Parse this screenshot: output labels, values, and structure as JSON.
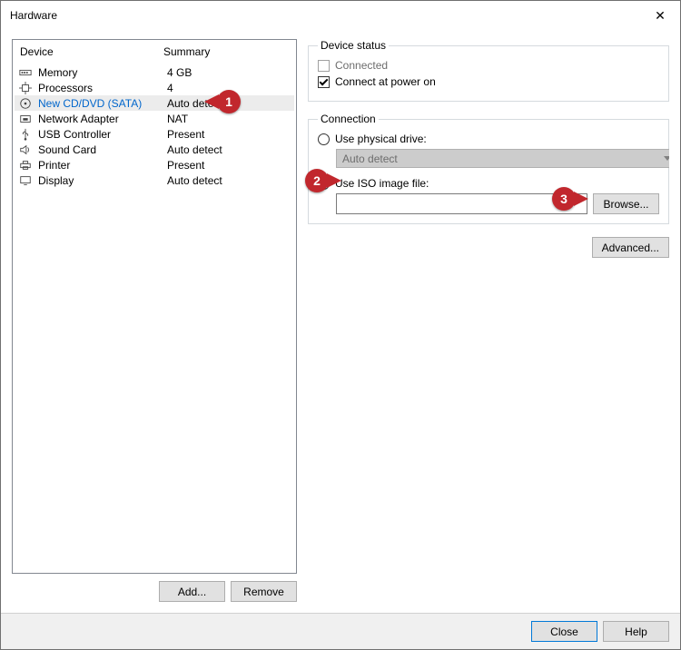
{
  "window": {
    "title": "Hardware",
    "close_icon": "✕"
  },
  "device_list": {
    "header_device": "Device",
    "header_summary": "Summary",
    "rows": [
      {
        "icon": "memory",
        "device": "Memory",
        "summary": "4 GB"
      },
      {
        "icon": "cpu",
        "device": "Processors",
        "summary": "4"
      },
      {
        "icon": "cd",
        "device": "New CD/DVD (SATA)",
        "summary": "Auto detect",
        "selected": true
      },
      {
        "icon": "net",
        "device": "Network Adapter",
        "summary": "NAT"
      },
      {
        "icon": "usb",
        "device": "USB Controller",
        "summary": "Present"
      },
      {
        "icon": "sound",
        "device": "Sound Card",
        "summary": "Auto detect"
      },
      {
        "icon": "printer",
        "device": "Printer",
        "summary": "Present"
      },
      {
        "icon": "display",
        "device": "Display",
        "summary": "Auto detect"
      }
    ]
  },
  "left_buttons": {
    "add": "Add...",
    "remove": "Remove"
  },
  "device_status": {
    "legend": "Device status",
    "connected_label": "Connected",
    "power_on_label": "Connect at power on"
  },
  "connection": {
    "legend": "Connection",
    "physical_label": "Use physical drive:",
    "physical_combo": "Auto detect",
    "iso_label": "Use ISO image file:",
    "iso_value": "",
    "browse": "Browse...",
    "advanced": "Advanced..."
  },
  "bottom": {
    "close": "Close",
    "help": "Help"
  },
  "callouts": {
    "c1": "1",
    "c2": "2",
    "c3": "3"
  }
}
